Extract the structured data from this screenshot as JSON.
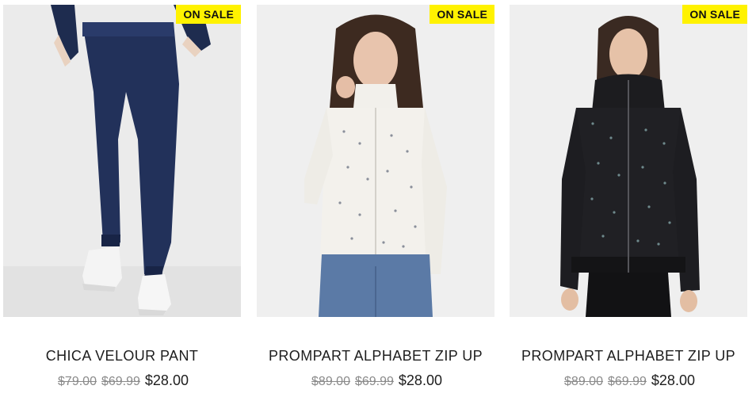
{
  "colors": {
    "badge_bg": "#fff200",
    "old_price": "#8a8a8a",
    "text": "#1d1d1d"
  },
  "products": [
    {
      "badge": "ON SALE",
      "name": "CHICA VELOUR PANT",
      "original_price": "$79.00",
      "previous_price": "$69.99",
      "sale_price": "$28.00",
      "image": "navy-velour-jogger-pants"
    },
    {
      "badge": "ON SALE",
      "name": "PROMPART ALPHABET ZIP UP",
      "original_price": "$89.00",
      "previous_price": "$69.99",
      "sale_price": "$28.00",
      "image": "white-printed-zip-up-hoodie"
    },
    {
      "badge": "ON SALE",
      "name": "PROMPART ALPHABET ZIP UP",
      "original_price": "$89.00",
      "previous_price": "$69.99",
      "sale_price": "$28.00",
      "image": "black-printed-zip-up-hoodie"
    }
  ]
}
